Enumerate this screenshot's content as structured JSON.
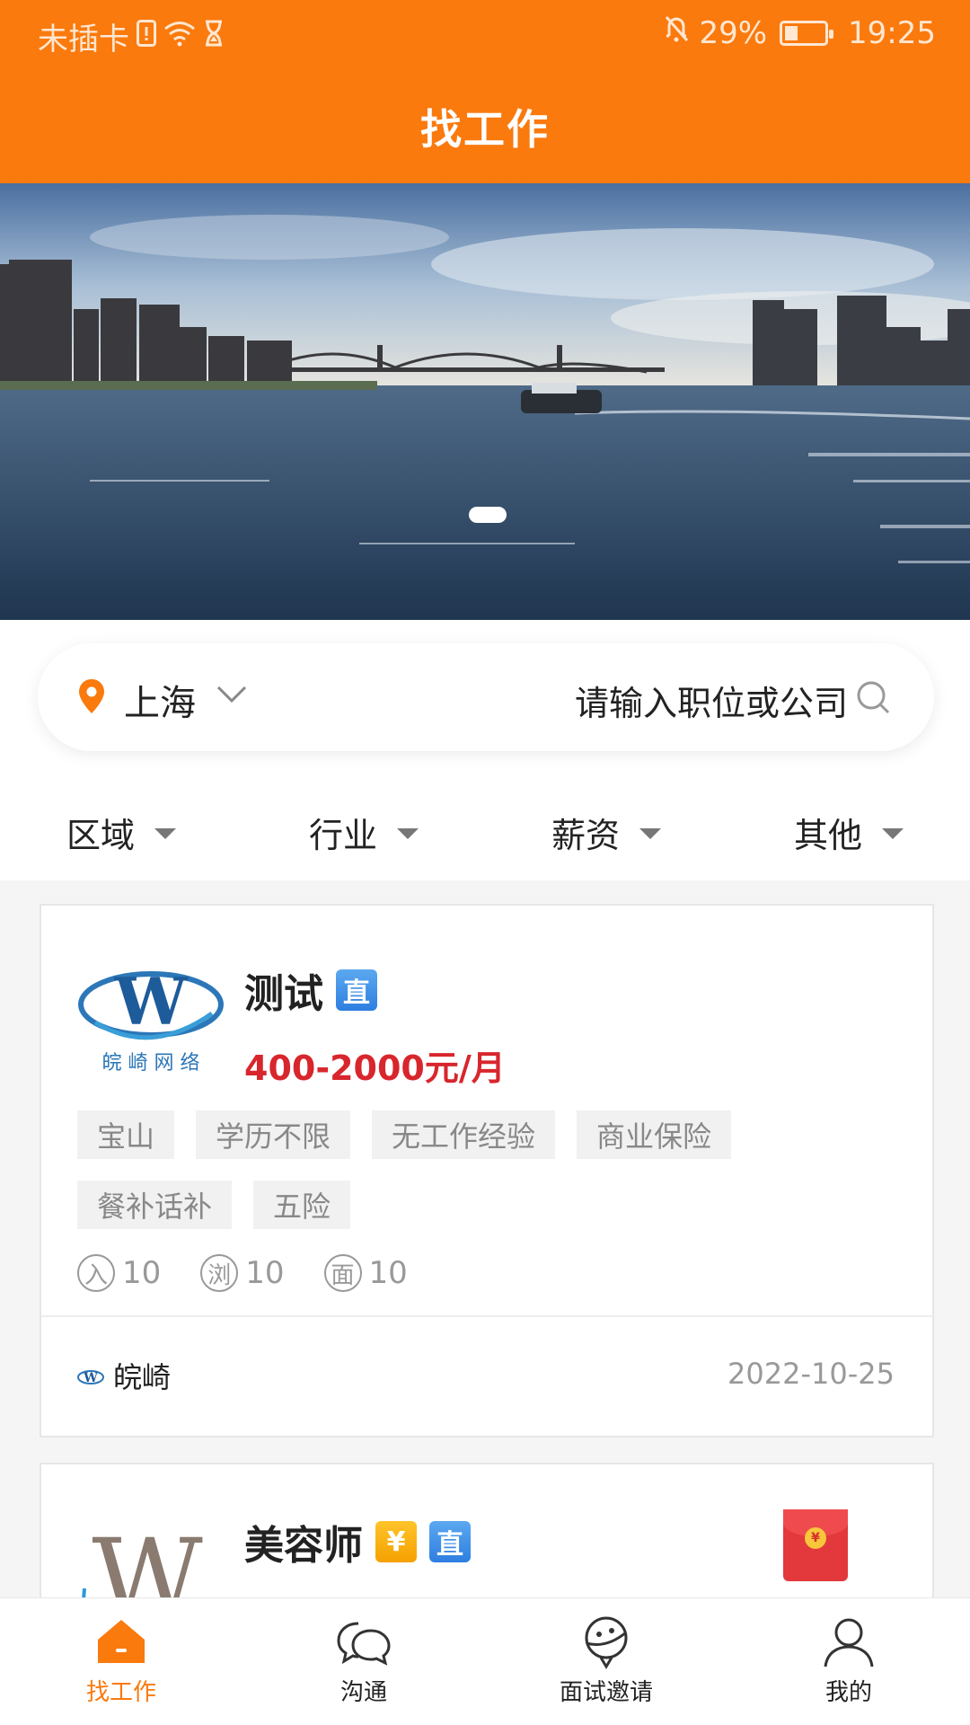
{
  "status_bar": {
    "carrier": "未插卡",
    "battery": "29%",
    "time": "19:25"
  },
  "header": {
    "title": "找工作"
  },
  "banner": {
    "slides": 1,
    "active_slide": 1
  },
  "search": {
    "city": "上海",
    "placeholder": "请输入职位或公司"
  },
  "filters": [
    {
      "label": "区域"
    },
    {
      "label": "行业"
    },
    {
      "label": "薪资"
    },
    {
      "label": "其他"
    }
  ],
  "jobs": [
    {
      "title": "测试",
      "badges": [
        "直"
      ],
      "salary": "400-2000元/月",
      "tags": [
        "宝山",
        "学历不限",
        "无工作经验",
        "商业保险",
        "餐补话补",
        "五险"
      ],
      "stats": [
        {
          "icon": "入",
          "value": "10"
        },
        {
          "icon": "浏",
          "value": "10"
        },
        {
          "icon": "面",
          "value": "10"
        }
      ],
      "company": "皖崎",
      "date": "2022-10-25",
      "logo_text": "皖 崎 网 络"
    },
    {
      "title": "美容师",
      "badges": [
        "¥",
        "直"
      ],
      "has_red_packet": true
    }
  ],
  "tabbar": [
    {
      "label": "找工作",
      "icon": "home-icon",
      "active": true
    },
    {
      "label": "沟通",
      "icon": "chat-icon",
      "active": false
    },
    {
      "label": "面试邀请",
      "icon": "interview-icon",
      "active": false
    },
    {
      "label": "我的",
      "icon": "user-icon",
      "active": false
    }
  ],
  "colors": {
    "brand": "#fa7a0e",
    "salary": "#d8262d",
    "badge_blue": "#2d7ee0",
    "badge_gold": "#f5a000"
  }
}
